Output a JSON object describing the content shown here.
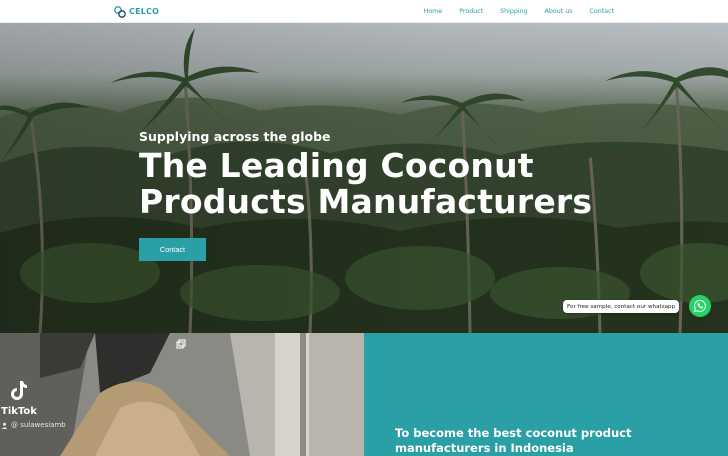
{
  "nav": {
    "brand": "CELCO",
    "items": [
      "Home",
      "Product",
      "Shipping",
      "About us",
      "Contact"
    ]
  },
  "hero": {
    "kicker": "Supplying across the globe",
    "title_line1": "The Leading Coconut",
    "title_line2": "Products Manufacturers",
    "cta": "Contact"
  },
  "whatsapp": {
    "tooltip": "For free sample, contact our whatsapp",
    "icon": "whatsapp-icon"
  },
  "video": {
    "platform": "TikTok",
    "username": "@ sulawesiamb"
  },
  "mission": {
    "text": "To become the best coconut product manufacturers in Indonesia"
  },
  "colors": {
    "accent": "#2a9fa6",
    "whatsapp": "#25d366",
    "text_light": "#ffffff"
  }
}
